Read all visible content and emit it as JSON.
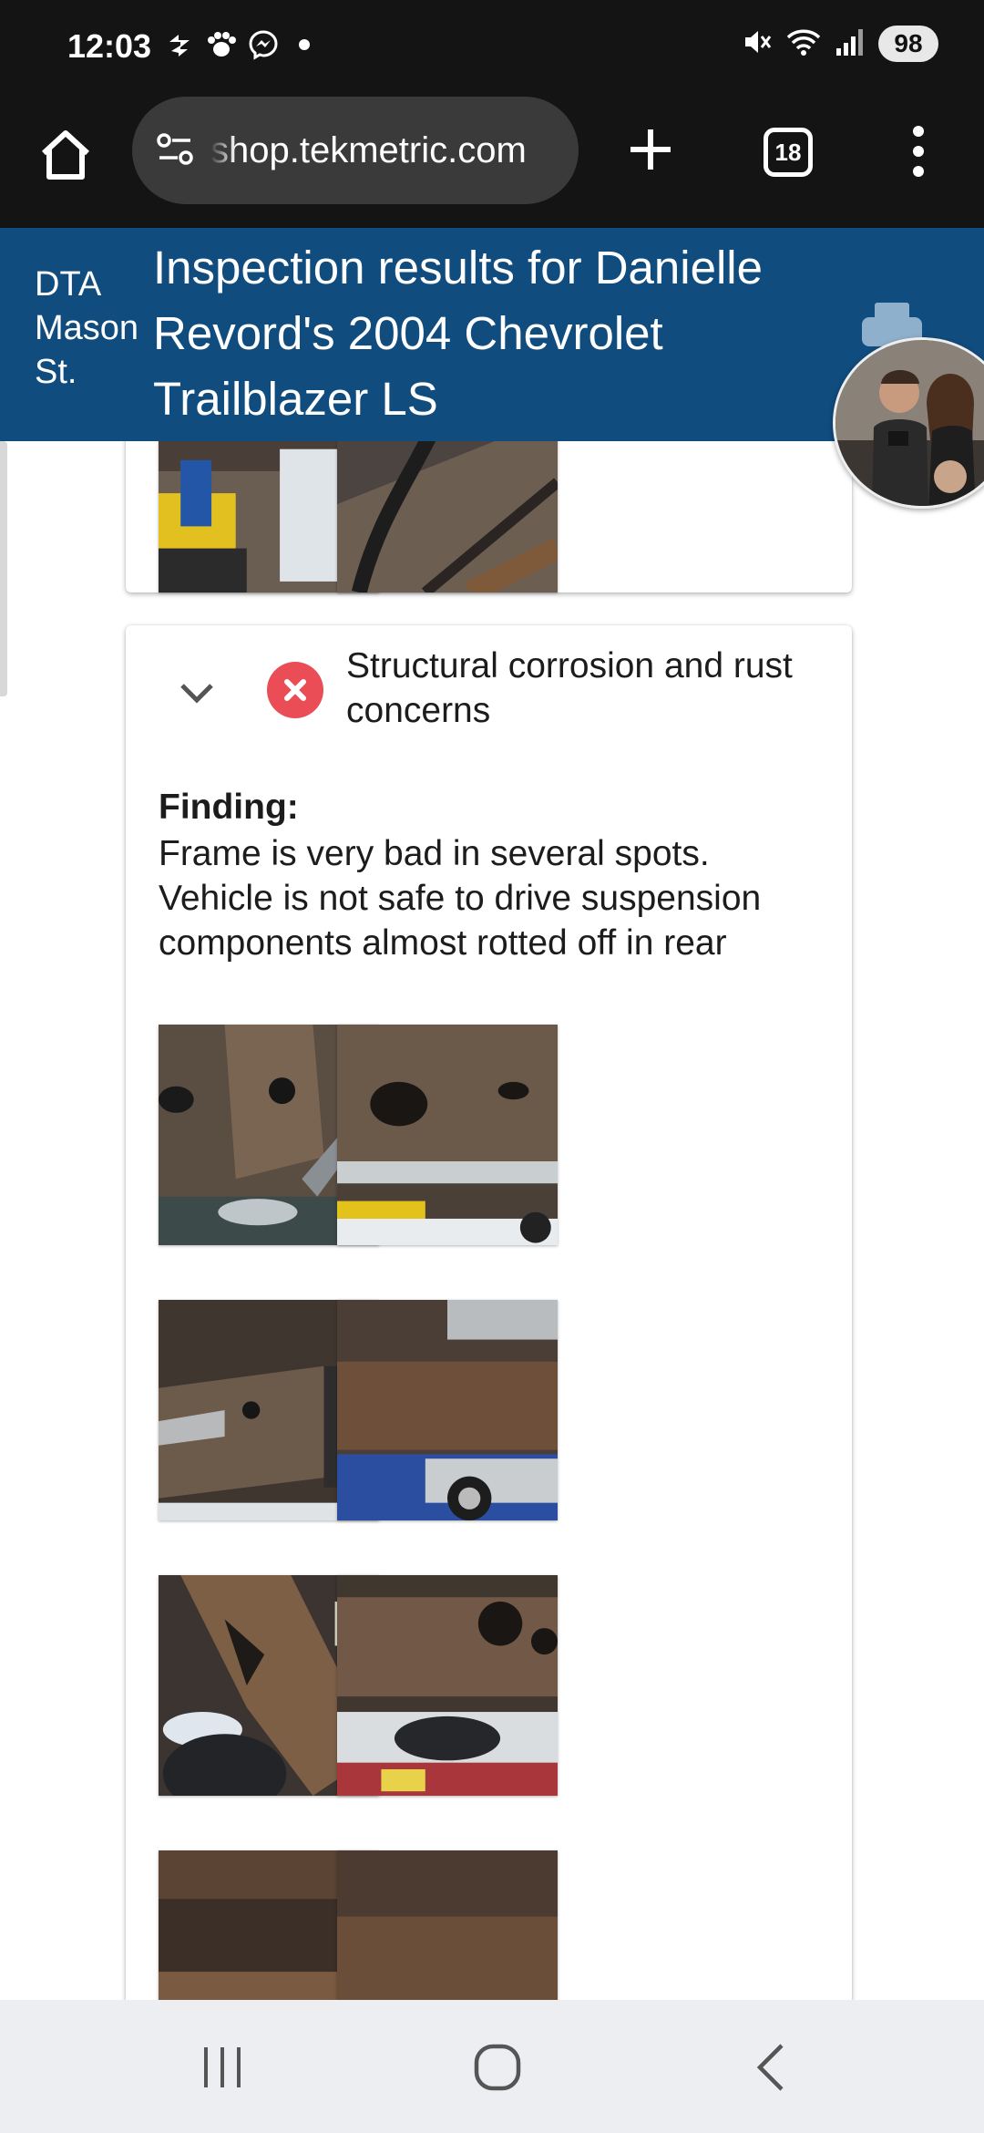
{
  "status_bar": {
    "time": "12:03",
    "left_icons": [
      "sync-icon",
      "paw-icon",
      "messenger-icon"
    ],
    "right_icons": [
      "mute-icon",
      "wifi-icon",
      "signal-icon"
    ],
    "battery": "98"
  },
  "browser": {
    "url": "shop.tekmetric.com",
    "tab_count": "18",
    "buttons": [
      "home",
      "new-tab",
      "tabs",
      "more"
    ]
  },
  "header": {
    "shop_name_lines": [
      "DTA",
      "Mason",
      "St."
    ],
    "title": "Inspection results for Danielle Revord's 2004 Chevrolet Trailblazer LS",
    "header_color": "#114c7e"
  },
  "concern": {
    "status": "fail",
    "status_color": "#ea4d55",
    "title": "Structural corrosion and rust concerns",
    "finding_label": "Finding:",
    "finding_text": "Frame is very bad in several spots. Vehicle is not safe to drive suspension components almost rotted off in rear"
  },
  "nav": {
    "buttons": [
      "recents",
      "home",
      "back"
    ]
  }
}
